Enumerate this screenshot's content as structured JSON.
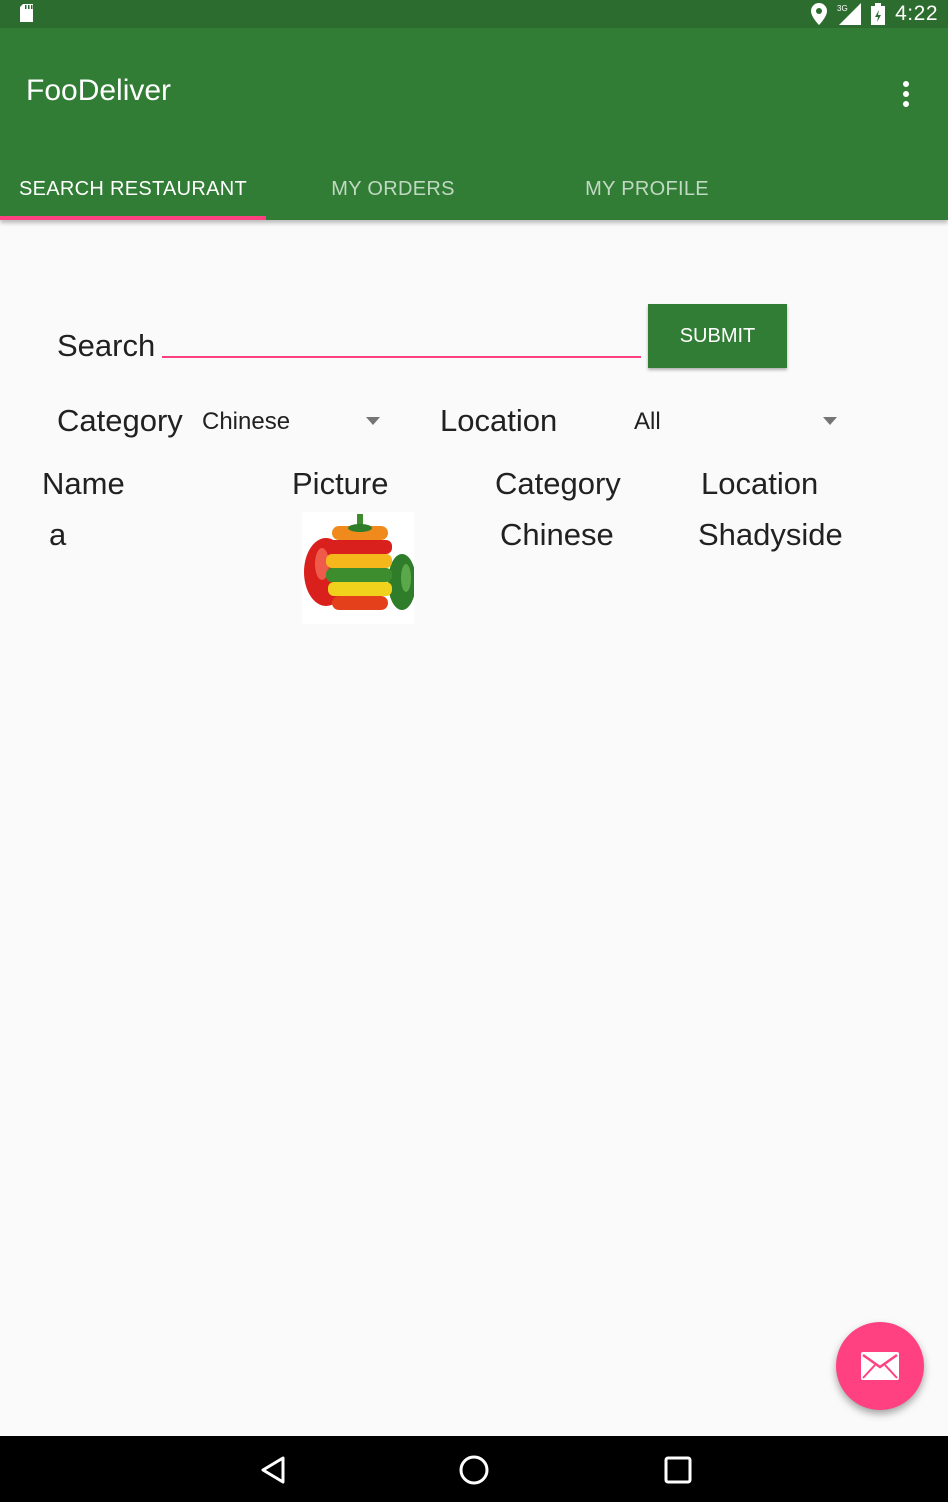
{
  "status_bar": {
    "time": "4:22",
    "icons": [
      "sd-card-icon",
      "location-icon",
      "signal-3g-icon",
      "battery-icon"
    ]
  },
  "app_bar": {
    "title": "FooDeliver",
    "overflow_icon": "more-vert-icon"
  },
  "tabs": [
    {
      "label": "SEARCH RESTAURANT",
      "active": true
    },
    {
      "label": "MY ORDERS",
      "active": false
    },
    {
      "label": "MY PROFILE",
      "active": false
    }
  ],
  "search": {
    "label": "Search",
    "value": "",
    "submit_label": "SUBMIT"
  },
  "filters": {
    "category_label": "Category",
    "category_value": "Chinese",
    "location_label": "Location",
    "location_value": "All"
  },
  "table": {
    "headers": [
      "Name",
      "Picture",
      "Category",
      "Location"
    ],
    "rows": [
      {
        "name": "a",
        "picture": "bell-pepper-image",
        "category": "Chinese",
        "location": "Shadyside"
      }
    ]
  },
  "fab": {
    "icon": "mail-icon"
  },
  "nav_bar": {
    "icons": [
      "back-icon",
      "home-icon",
      "recents-icon"
    ]
  },
  "colors": {
    "primary": "#317d35",
    "primary_dark": "#2c6d2f",
    "accent": "#ff4081",
    "background": "#fafafa"
  }
}
